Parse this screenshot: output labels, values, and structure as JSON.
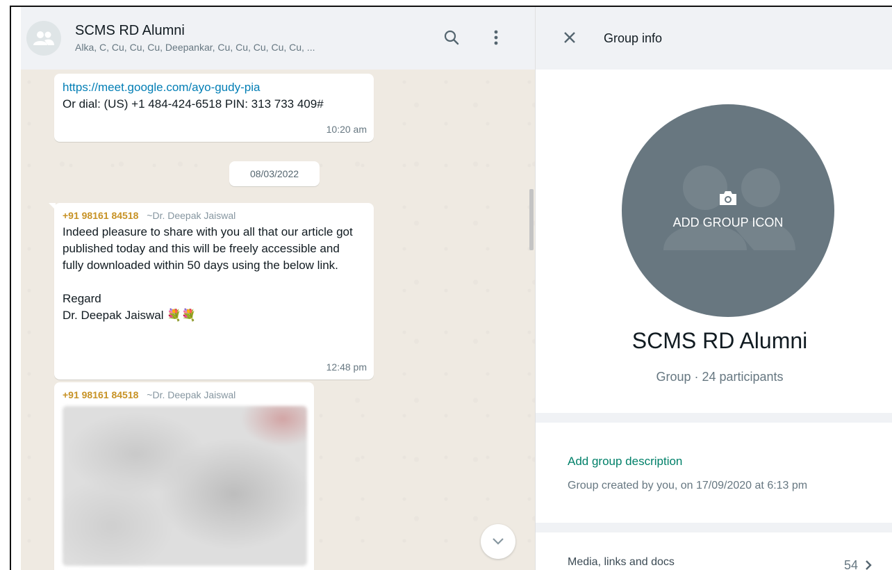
{
  "chat": {
    "title": "SCMS RD Alumni",
    "subtitle": "Alka, C, Cu, Cu, Cu, Deepankar, Cu, Cu, Cu, Cu, Cu, ...",
    "messages": [
      {
        "link": "https://meet.google.com/ayo-gudy-pia",
        "text": "Or dial: (US) +1 484-424-6518 PIN: 313 733 409#",
        "time": "10:20 am"
      },
      {
        "sender_phone": "+91 98161 84518",
        "sender_alias": "~Dr. Deepak Jaiswal",
        "line1": "Indeed pleasure to share with you all that our article got published today and this will be freely accessible and fully downloaded within 50 days using the below link.",
        "line2": "Regard",
        "line3": "Dr. Deepak Jaiswal 💐💐",
        "time": "12:48 pm"
      },
      {
        "sender_phone": "+91 98161 84518",
        "sender_alias": "~Dr. Deepak Jaiswal"
      }
    ],
    "date_divider": "08/03/2022"
  },
  "info": {
    "header_title": "Group info",
    "add_icon_label": "ADD GROUP ICON",
    "group_name": "SCMS RD Alumni",
    "group_meta": "Group · 24 participants",
    "add_description": "Add group description",
    "created": "Group created by you, on 17/09/2020 at 6:13 pm",
    "media_label": "Media, links and docs",
    "media_count": "54"
  },
  "colors": {
    "accent_green": "#008069",
    "sender_gold": "#c79225",
    "link_blue": "#027eb5",
    "group_icon_bg": "#687780"
  },
  "icons": [
    "group-avatar-icon",
    "search-icon",
    "menu-icon",
    "close-icon",
    "camera-icon",
    "chevron-down-icon",
    "chevron-right-icon"
  ]
}
